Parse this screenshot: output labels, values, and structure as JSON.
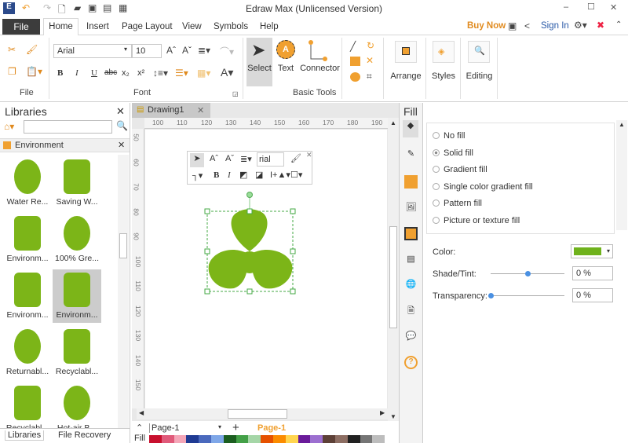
{
  "window": {
    "title": "Edraw Max (Unlicensed Version)",
    "minimize": "–",
    "maximize": "☐",
    "close": "✕"
  },
  "menu": {
    "file": "File",
    "tabs": [
      "Home",
      "Insert",
      "Page Layout",
      "View",
      "Symbols",
      "Help"
    ],
    "buy_now": "Buy Now",
    "sign_in": "Sign In"
  },
  "ribbon": {
    "font_name": "Arial",
    "font_size": "10",
    "groups": {
      "file": "File",
      "font": "Font",
      "basic_tools": "Basic Tools"
    },
    "select": "Select",
    "text": "Text",
    "connector": "Connector",
    "arrange": "Arrange",
    "styles": "Styles",
    "editing": "Editing",
    "format_buttons": [
      "B",
      "I",
      "U",
      "abc",
      "x₂",
      "x²"
    ]
  },
  "libraries": {
    "title": "Libraries",
    "search_placeholder": "",
    "category": "Environment",
    "items": [
      {
        "label": "Water Re..."
      },
      {
        "label": "Saving W..."
      },
      {
        "label": "Environm..."
      },
      {
        "label": "100% Gre..."
      },
      {
        "label": "Environm..."
      },
      {
        "label": "Environm...",
        "selected": true
      },
      {
        "label": "Returnabl..."
      },
      {
        "label": "Recyclabl..."
      },
      {
        "label": "Recyclabl..."
      },
      {
        "label": "Hot-air B..."
      }
    ],
    "bottom_tabs": [
      "Libraries",
      "File Recovery"
    ]
  },
  "document": {
    "tab": "Drawing1",
    "ruler_h": [
      "100",
      "110",
      "120",
      "130",
      "140",
      "150",
      "160",
      "170",
      "180",
      "190"
    ],
    "ruler_v": [
      "50",
      "60",
      "70",
      "80",
      "90",
      "100",
      "110",
      "120",
      "130",
      "140",
      "150"
    ],
    "float_toolbar": {
      "font": "rial",
      "bold": "B",
      "italic": "I"
    },
    "shape_color": "#7cb518"
  },
  "pages": {
    "current": "Page-1",
    "tab": "Page-1",
    "add": "+",
    "fill_label": "Fill"
  },
  "fill": {
    "title": "Fill",
    "options": [
      "No fill",
      "Solid fill",
      "Gradient fill",
      "Single color gradient fill",
      "Pattern fill",
      "Picture or texture fill"
    ],
    "selected": "Solid fill",
    "color_label": "Color:",
    "color": "#6fb21c",
    "shade_label": "Shade/Tint:",
    "shade_value": "0 %",
    "shade_level": 0.5,
    "transparency_label": "Transparency:",
    "transparency_value": "0 %",
    "transparency_level": 0
  },
  "palette": [
    "#c8102e",
    "#e05a7a",
    "#f4a6b8",
    "#1f3a93",
    "#4a69bd",
    "#7fa7e8",
    "#1b5e20",
    "#43a047",
    "#a5d6a7",
    "#e65100",
    "#fb8c00",
    "#ffd54f",
    "#6a1b9a",
    "#9c6fd0",
    "#5d4037",
    "#8d6e63",
    "#212121",
    "#757575",
    "#bdbdbd"
  ]
}
